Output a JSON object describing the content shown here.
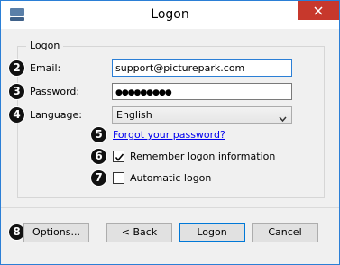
{
  "window": {
    "title": "Logon",
    "app_icon": "window-app-icon",
    "close_icon": "close-icon"
  },
  "group": {
    "label": "Logon"
  },
  "badges": {
    "email": "2",
    "password": "3",
    "language": "4",
    "forgot": "5",
    "remember": "6",
    "automatic": "7",
    "options": "8"
  },
  "fields": {
    "email_label": "Email:",
    "email_value": "support@picturepark.com",
    "password_label": "Password:",
    "password_value": "●●●●●●●●●",
    "language_label": "Language:",
    "language_value": "English"
  },
  "links": {
    "forgot_password": "Forgot your password?"
  },
  "checkboxes": {
    "remember_label": "Remember logon information",
    "remember_checked": true,
    "automatic_label": "Automatic logon",
    "automatic_checked": false
  },
  "buttons": {
    "options": "Options...",
    "back": "< Back",
    "logon": "Logon",
    "cancel": "Cancel"
  },
  "colors": {
    "close_button": "#c7382c",
    "link": "#0000ee",
    "focus_border": "#2b7fd6",
    "badge": "#111111"
  }
}
